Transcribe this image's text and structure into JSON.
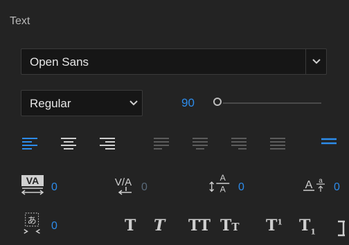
{
  "panel": {
    "title": "Text"
  },
  "font": {
    "family": "Open Sans",
    "style": "Regular"
  },
  "size": {
    "value": "90",
    "slider_fraction": 0.0
  },
  "alignment": {
    "buttons": [
      {
        "name": "align-left",
        "active": true
      },
      {
        "name": "align-center",
        "active": false
      },
      {
        "name": "align-right",
        "active": false
      },
      {
        "name": "justify-left",
        "active": false
      },
      {
        "name": "justify-center",
        "active": false
      },
      {
        "name": "justify-right",
        "active": false
      },
      {
        "name": "justify-all",
        "active": false
      },
      {
        "name": "overflow-menu",
        "active": true
      }
    ]
  },
  "metrics": {
    "tracking": "0",
    "kerning": "0",
    "leading": "0",
    "baseline_shift": "0",
    "tsume": "0"
  },
  "type_styles": {
    "faux_bold": "T",
    "faux_italic": "T",
    "all_caps": "TT",
    "small_caps": "Tt",
    "superscript": "T",
    "subscript": "T"
  },
  "colors": {
    "accent": "#2d8ceb",
    "background": "#232323",
    "field": "#161616"
  }
}
